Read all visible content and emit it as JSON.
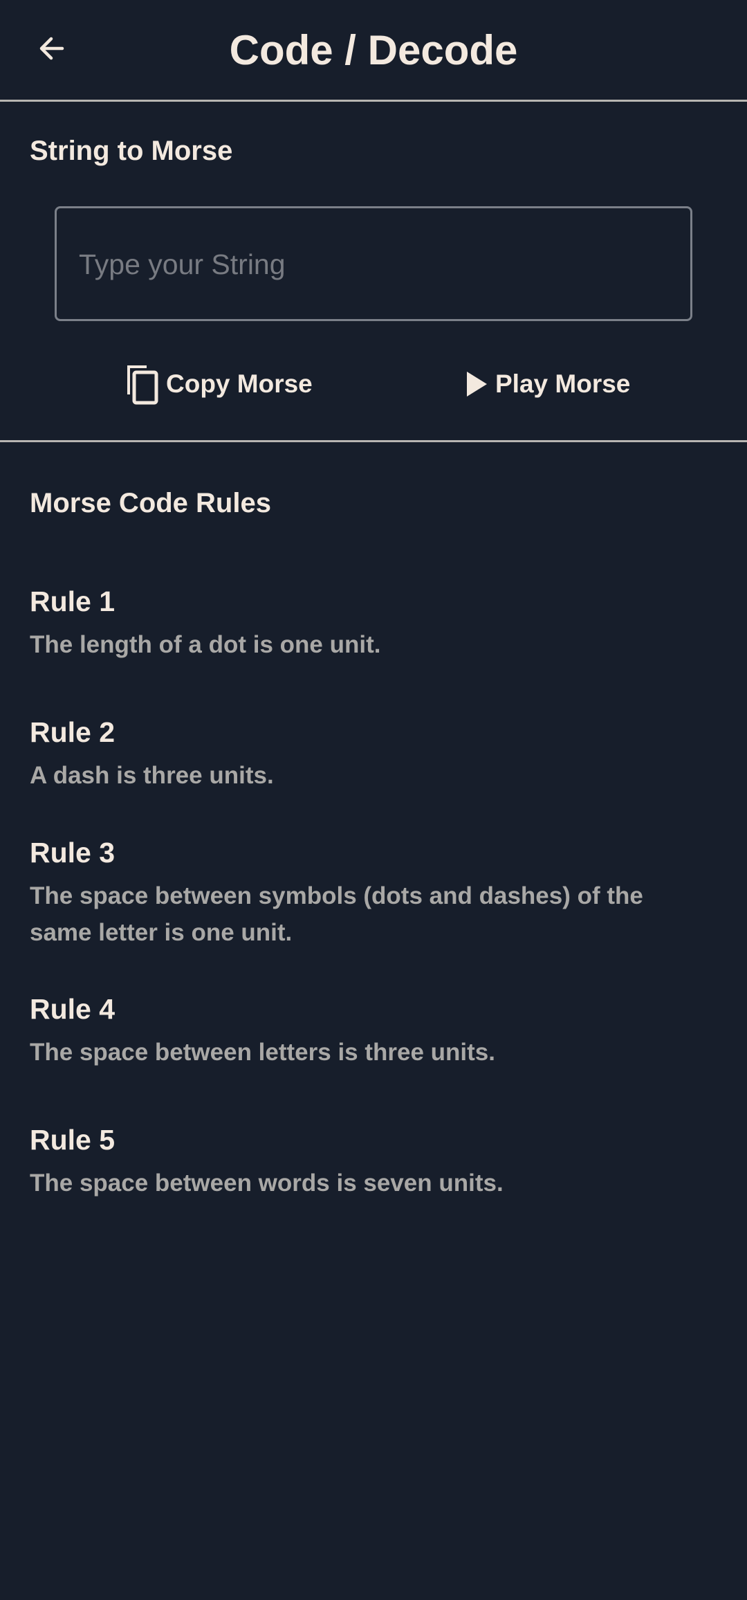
{
  "app_bar": {
    "title": "Code / Decode",
    "back_icon": "arrow-back-icon"
  },
  "string_to_morse": {
    "title": "String to Morse",
    "input_placeholder": "Type your String",
    "input_value": "",
    "copy_label": "Copy Morse",
    "copy_icon": "copy-icon",
    "play_label": "Play Morse",
    "play_icon": "play-icon"
  },
  "rules_section": {
    "title": "Morse Code Rules",
    "rules": [
      {
        "title": "Rule 1",
        "text": "The length of a dot is one unit."
      },
      {
        "title": "Rule 2",
        "text": "A dash is three units."
      },
      {
        "title": "Rule 3",
        "text": "The space between symbols (dots and dashes) of the same letter is one unit."
      },
      {
        "title": "Rule 4",
        "text": "The space between letters is three units."
      },
      {
        "title": "Rule 5",
        "text": "The space between words is seven units."
      }
    ]
  },
  "colors": {
    "background": "#171e2b",
    "primary_text": "#f3e9df",
    "secondary_text": "#a9a8a6",
    "divider": "#b8b6b2",
    "input_border": "#7b8089"
  }
}
